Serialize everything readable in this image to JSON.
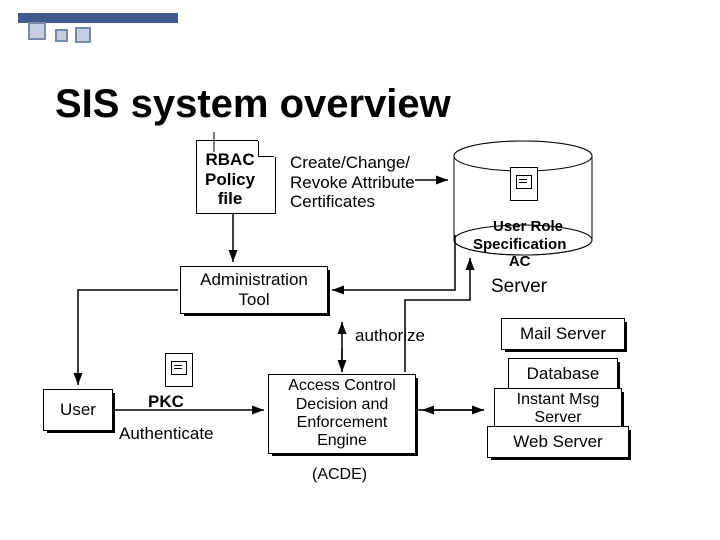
{
  "title": "SIS system overview",
  "rbac_file": "RBAC\nPolicy\nfile",
  "create_change": "Create/Change/\nRevoke Attribute\nCertificates",
  "user_role_spec": "User Role\nSpecification\nAC",
  "admin_tool": "Administration\nTool",
  "server": "Server",
  "authorize": "authorize",
  "mail_server": "Mail Server",
  "database": "Database",
  "user": "User",
  "pkc": "PKC",
  "authenticate": "Authenticate",
  "acde": "Access Control\nDecision and\nEnforcement\nEngine",
  "acde_abbrev": "(ACDE)",
  "instant_msg": "Instant Msg\nServer",
  "web_server": "Web  Server"
}
